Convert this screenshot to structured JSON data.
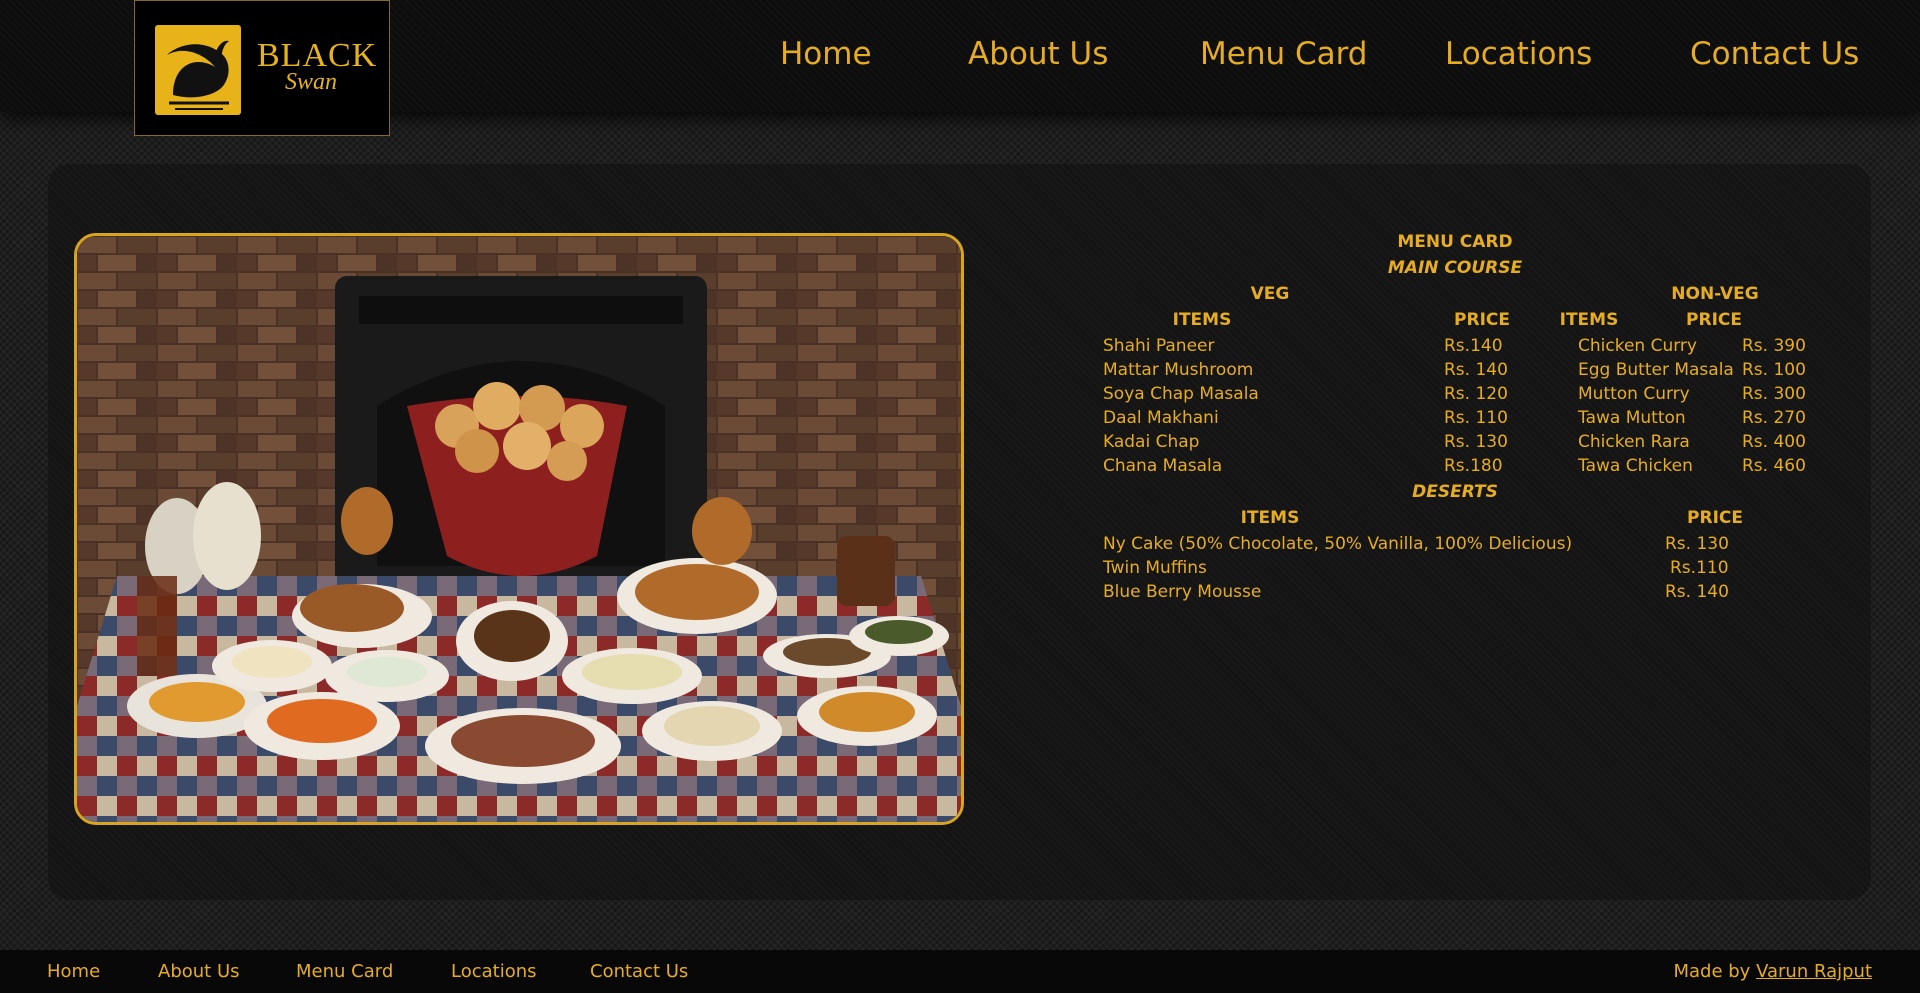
{
  "brand": {
    "name": "BLACK",
    "script": "Swan"
  },
  "nav": [
    "Home",
    "About Us",
    "Menu Card",
    "Locations",
    "Contact Us"
  ],
  "menu": {
    "title": "MENU CARD",
    "main_course": "MAIN COURSE",
    "veg": {
      "heading": "VEG",
      "items_header": "ITEMS",
      "price_header": "PRICE",
      "rows": [
        {
          "item": "Shahi Paneer",
          "price": "Rs.140"
        },
        {
          "item": "Mattar Mushroom",
          "price": "Rs. 140"
        },
        {
          "item": "Soya Chap Masala",
          "price": "Rs. 120"
        },
        {
          "item": "Daal Makhani",
          "price": "Rs. 110"
        },
        {
          "item": "Kadai Chap",
          "price": "Rs. 130"
        },
        {
          "item": "Chana Masala",
          "price": "Rs.180"
        }
      ]
    },
    "nonveg": {
      "heading": "NON-VEG",
      "items_header": "ITEMS",
      "price_header": "PRICE",
      "rows": [
        {
          "item": "Chicken Curry",
          "price": "Rs. 390"
        },
        {
          "item": "Egg Butter Masala",
          "price": "Rs. 100"
        },
        {
          "item": "Mutton Curry",
          "price": "Rs. 300"
        },
        {
          "item": "Tawa Mutton",
          "price": "Rs. 270"
        },
        {
          "item": "Chicken Rara",
          "price": "Rs. 400"
        },
        {
          "item": "Tawa Chicken",
          "price": "Rs. 460"
        }
      ]
    },
    "deserts": {
      "heading": "DESERTS",
      "items_header": "ITEMS",
      "price_header": "PRICE",
      "rows": [
        {
          "item": "Ny Cake (50% Chocolate, 50% Vanilla, 100% Delicious)",
          "price": "Rs. 130"
        },
        {
          "item": "Twin Muffins",
          "price": "Rs.110"
        },
        {
          "item": "Blue Berry Mousse",
          "price": "Rs. 140"
        }
      ]
    }
  },
  "footer": {
    "links": [
      "Home",
      "About Us",
      "Menu Card",
      "Locations",
      "Contact Us"
    ],
    "credit_prefix": "Made by",
    "credit_name": "Varun Rajput"
  },
  "colors": {
    "accent": "#e6ad22",
    "background": "#1e1e1e",
    "panel": "#141414"
  }
}
